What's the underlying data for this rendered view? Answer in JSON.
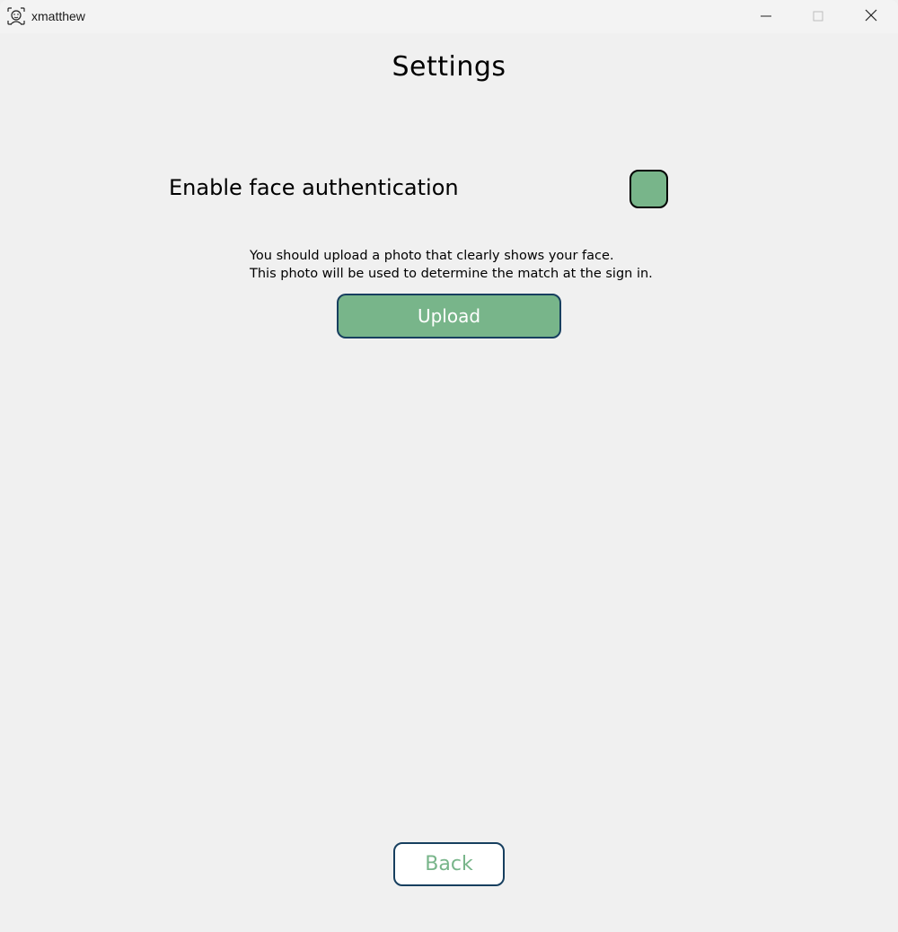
{
  "window": {
    "title": "xmatthew",
    "app_icon": "face-scan-icon",
    "controls": {
      "minimize_icon": "minimize-icon",
      "maximize_icon": "maximize-icon",
      "close_icon": "close-icon"
    }
  },
  "page": {
    "title": "Settings"
  },
  "face_auth": {
    "label": "Enable face authentication",
    "toggle_color": "#78b58a",
    "info_line_1": "You should upload a photo that clearly shows your face.",
    "info_line_2": "This photo will be used to determine the match at the sign in.",
    "upload_label": "Upload"
  },
  "footer": {
    "back_label": "Back"
  },
  "colors": {
    "accent_green": "#78b58a",
    "border_navy": "#173f5f",
    "background": "#f0f0f0"
  }
}
